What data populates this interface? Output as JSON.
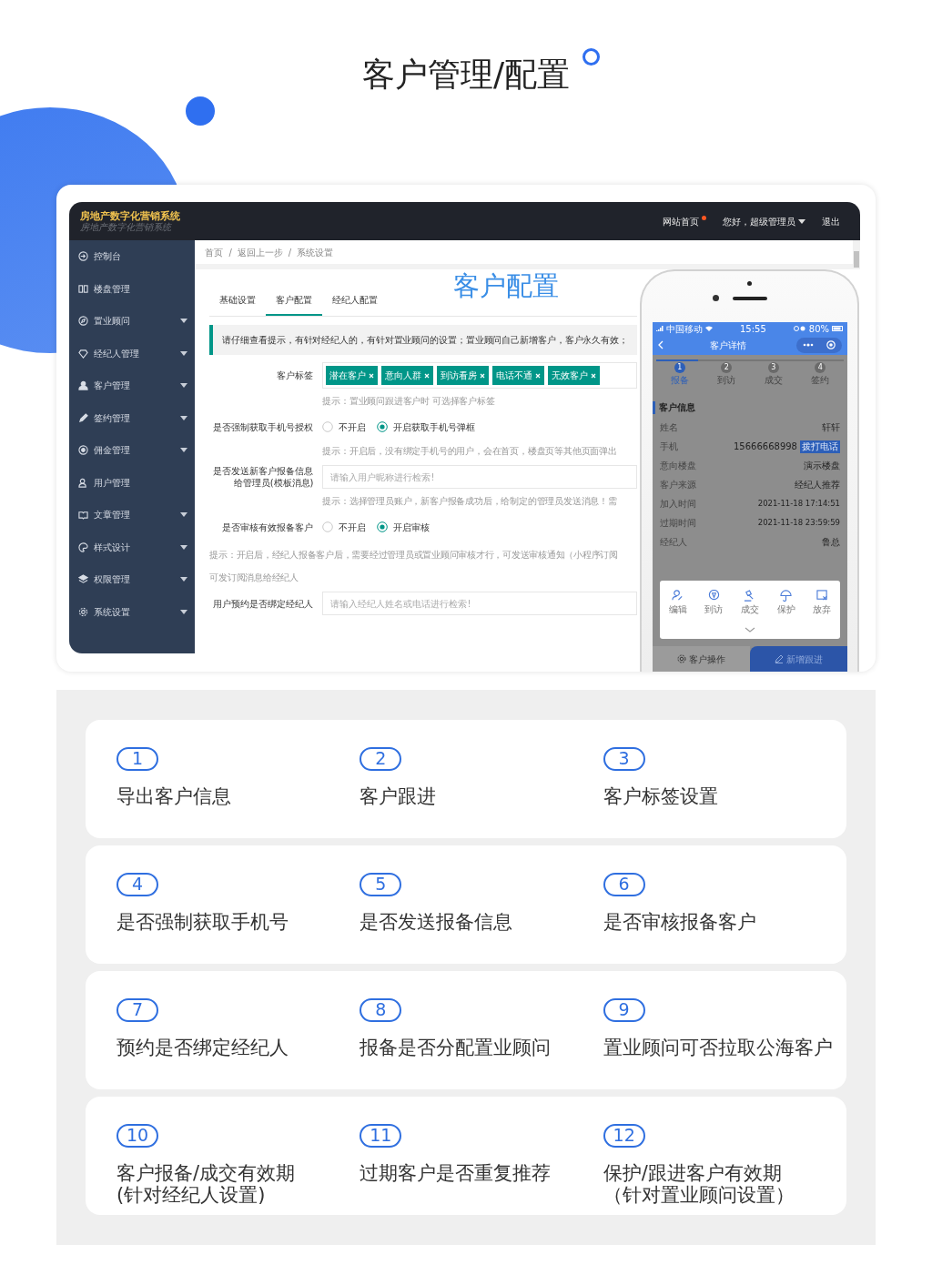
{
  "page_title": "客户管理/配置",
  "app": {
    "brand": {
      "title": "房地产数字化营销系统",
      "subtitle": "房地产数字化营销系统"
    },
    "top_nav": [
      {
        "label": "网站首页",
        "dot": true,
        "dropdown": false
      },
      {
        "label": "您好，超级管理员",
        "dot": false,
        "dropdown": true
      },
      {
        "label": "退出",
        "dot": false,
        "dropdown": false
      }
    ],
    "sidebar": [
      {
        "label": "控制台",
        "expandable": false
      },
      {
        "label": "楼盘管理",
        "expandable": false
      },
      {
        "label": "置业顾问",
        "expandable": true
      },
      {
        "label": "经纪人管理",
        "expandable": true
      },
      {
        "label": "客户管理",
        "expandable": true
      },
      {
        "label": "签约管理",
        "expandable": true
      },
      {
        "label": "佣金管理",
        "expandable": true
      },
      {
        "label": "用户管理",
        "expandable": false
      },
      {
        "label": "文章管理",
        "expandable": true
      },
      {
        "label": "样式设计",
        "expandable": true
      },
      {
        "label": "权限管理",
        "expandable": true
      },
      {
        "label": "系统设置",
        "expandable": true
      }
    ],
    "breadcrumb": [
      "首页",
      "返回上一步",
      "系统设置"
    ],
    "breadcrumb_separator": "/",
    "tabs": [
      {
        "label": "基础设置",
        "selected": false
      },
      {
        "label": "客户配置",
        "selected": true
      },
      {
        "label": "经纪人配置",
        "selected": false
      }
    ],
    "heading": "客户配置",
    "notice": "请仔细查看提示，有针对经纪人的，有针对置业顾问的设置；置业顾问自己新增客户，客户永久有效；",
    "form": [
      {
        "kind": "tags",
        "label": "客户标签",
        "tags": [
          "潜在客户",
          "意向人群",
          "到访看房",
          "电话不通",
          "无效客户"
        ],
        "hint": "提示：置业顾问跟进客户时 可选择客户标签"
      },
      {
        "kind": "radio",
        "label": "是否强制获取手机号授权",
        "options": [
          {
            "label": "不开启",
            "selected": false
          },
          {
            "label": "开启获取手机号弹框",
            "selected": true
          }
        ],
        "hint": "提示：开启后，没有绑定手机号的用户，会在首页，楼盘页等其他页面弹出"
      },
      {
        "kind": "input",
        "label": "是否发送新客户报备信息给管理员(模板消息)",
        "placeholder": "请输入用户昵称进行检索!",
        "hint": "提示：选择管理员账户，新客户报备成功后，给制定的管理员发送消息！需"
      },
      {
        "kind": "radio",
        "label": "是否审核有效报备客户",
        "options": [
          {
            "label": "不开启",
            "selected": false
          },
          {
            "label": "开启审核",
            "selected": true
          }
        ]
      },
      {
        "kind": "note",
        "text": "提示：开启后，经纪人报备客户后，需要经过管理员或置业顾问审核才行，可发送审核通知（小程序订阅"
      },
      {
        "kind": "note",
        "text": "可发订阅消息给经纪人"
      },
      {
        "kind": "input",
        "label": "用户预约是否绑定经纪人",
        "placeholder": "请输入经纪人姓名或电话进行检索!"
      }
    ]
  },
  "phone": {
    "carrier": "中国移动",
    "time": "15:55",
    "battery": "80%",
    "title": "客户详情",
    "steps": [
      {
        "number": "1",
        "label": "报备",
        "selected": true
      },
      {
        "number": "2",
        "label": "到访",
        "selected": false
      },
      {
        "number": "3",
        "label": "成交",
        "selected": false
      },
      {
        "number": "4",
        "label": "签约",
        "selected": false
      }
    ],
    "section": "客户信息",
    "fields": [
      {
        "label": "姓名",
        "value": "轩轩"
      },
      {
        "label": "手机",
        "value": "15666668998",
        "action": "拨打电话"
      },
      {
        "label": "意向楼盘",
        "value": "演示楼盘"
      },
      {
        "label": "客户来源",
        "value": "经纪人推荐"
      },
      {
        "label": "加入时间",
        "value": "2021-11-18 17:14:51"
      },
      {
        "label": "过期时间",
        "value": "2021-11-18 23:59:59"
      },
      {
        "label": "经纪人",
        "value": "鲁总"
      }
    ],
    "actions": [
      "编辑",
      "到访",
      "成交",
      "保护",
      "放弃"
    ],
    "bottom_buttons": [
      {
        "label": "客户操作",
        "primary": false
      },
      {
        "label": "新增跟进",
        "primary": true
      }
    ]
  },
  "feature_rows": [
    [
      {
        "number": "1",
        "lines": [
          "导出客户信息"
        ]
      },
      {
        "number": "2",
        "lines": [
          "客户跟进"
        ]
      },
      {
        "number": "3",
        "lines": [
          "客户标签设置"
        ]
      }
    ],
    [
      {
        "number": "4",
        "lines": [
          "是否强制获取手机号"
        ]
      },
      {
        "number": "5",
        "lines": [
          "是否发送报备信息"
        ]
      },
      {
        "number": "6",
        "lines": [
          "是否审核报备客户"
        ]
      }
    ],
    [
      {
        "number": "7",
        "lines": [
          "预约是否绑定经纪人"
        ]
      },
      {
        "number": "8",
        "lines": [
          "报备是否分配置业顾问"
        ]
      },
      {
        "number": "9",
        "lines": [
          "置业顾问可否拉取公海客户"
        ]
      }
    ],
    [
      {
        "number": "10",
        "lines": [
          "客户报备/成交有效期",
          "(针对经纪人设置)"
        ]
      },
      {
        "number": "11",
        "lines": [
          "过期客户是否重复推荐"
        ]
      },
      {
        "number": "12",
        "lines": [
          "保护/跟进客户有效期",
          "（针对置业顾问设置）"
        ]
      }
    ]
  ]
}
